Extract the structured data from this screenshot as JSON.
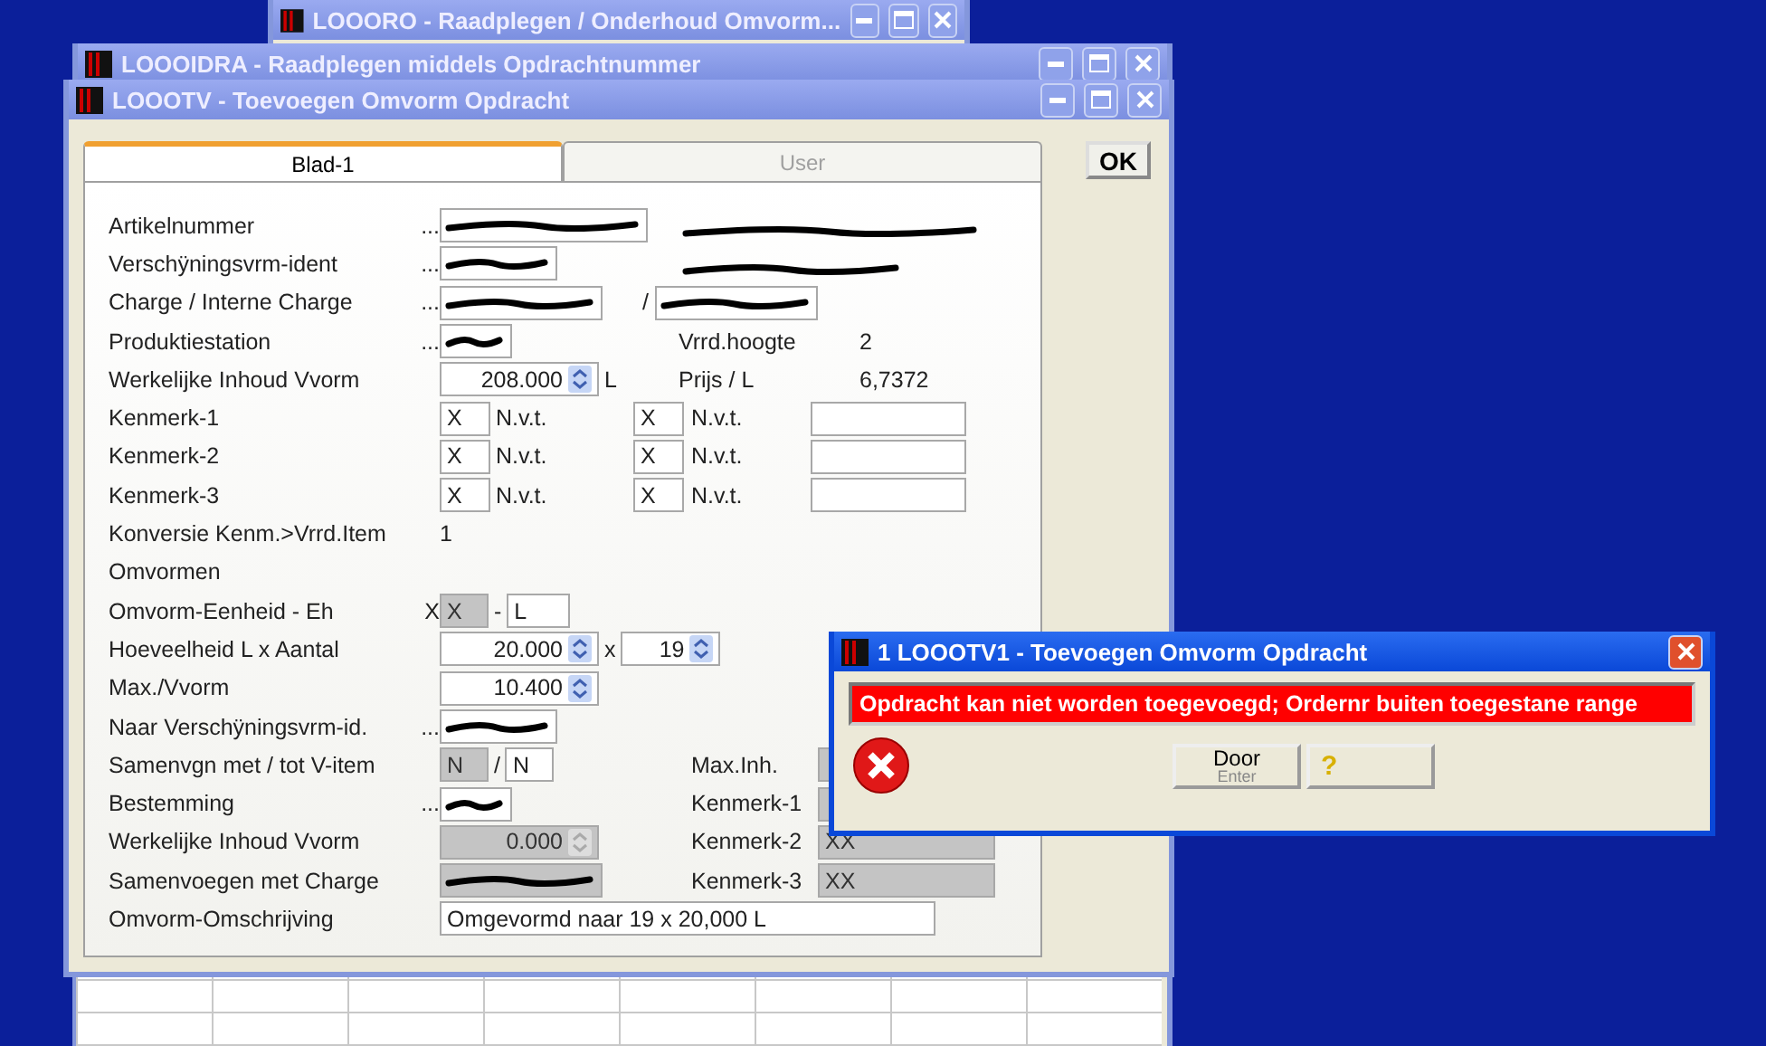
{
  "windows_behind": [
    {
      "title": "LOOORO - Raadplegen / Onderhoud Omvorm..."
    },
    {
      "title": "LOOOIDRA - Raadplegen middels Opdrachtnummer"
    }
  ],
  "window": {
    "title": "LOOOTV - Toevoegen Omvorm Opdracht"
  },
  "tabs": [
    {
      "label": "Blad-1",
      "selected": true
    },
    {
      "label": "User",
      "selected": false
    }
  ],
  "ok_button": "OK",
  "form": {
    "rows": [
      {
        "label": "Artikelnummer",
        "pre": "...",
        "left": [
          {
            "kind": "field",
            "redacted": true
          }
        ],
        "right": [
          {
            "kind": "note",
            "redacted": true
          }
        ]
      },
      {
        "label": "Verschÿningsvrm-ident",
        "pre": "...",
        "left": [
          {
            "kind": "field",
            "redacted": true
          }
        ],
        "right": [
          {
            "kind": "note",
            "redacted": true
          }
        ]
      },
      {
        "label": "Charge / Interne Charge",
        "pre": "...",
        "left": [
          {
            "kind": "field",
            "redacted": true
          }
        ],
        "right": [
          {
            "kind": "text",
            "text": "/"
          },
          {
            "kind": "field",
            "redacted": true
          }
        ]
      },
      {
        "label": "Produktiestation",
        "pre": "...",
        "left": [
          {
            "kind": "field",
            "redacted": true
          }
        ],
        "right": [
          {
            "kind": "text",
            "text": "Vrrd.hoogte"
          },
          {
            "kind": "text",
            "text": "2"
          }
        ]
      },
      {
        "label": "Werkelijke Inhoud Vvorm",
        "left": [
          {
            "kind": "spin",
            "value": "208.000"
          },
          {
            "kind": "text",
            "text": "L"
          }
        ],
        "right": [
          {
            "kind": "text",
            "text": "Prijs / L"
          },
          {
            "kind": "text",
            "text": "6,7372"
          }
        ]
      },
      {
        "label": "Kenmerk-1",
        "left": [
          {
            "kind": "field",
            "value": "X"
          },
          {
            "kind": "text",
            "text": "N.v.t."
          }
        ],
        "right": [
          {
            "kind": "field",
            "value": "X"
          },
          {
            "kind": "text",
            "text": "N.v.t."
          },
          {
            "kind": "field"
          }
        ]
      },
      {
        "label": "Kenmerk-2",
        "left": [
          {
            "kind": "field",
            "value": "X"
          },
          {
            "kind": "text",
            "text": "N.v.t."
          }
        ],
        "right": [
          {
            "kind": "field",
            "value": "X"
          },
          {
            "kind": "text",
            "text": "N.v.t."
          },
          {
            "kind": "field"
          }
        ]
      },
      {
        "label": "Kenmerk-3",
        "left": [
          {
            "kind": "field",
            "value": "X"
          },
          {
            "kind": "text",
            "text": "N.v.t."
          }
        ],
        "right": [
          {
            "kind": "field",
            "value": "X"
          },
          {
            "kind": "text",
            "text": "N.v.t."
          },
          {
            "kind": "field"
          }
        ]
      },
      {
        "label": "Konversie Kenm.>Vrrd.Item",
        "left": [
          {
            "kind": "text",
            "text": "1"
          }
        ]
      },
      {
        "label": "Omvormen"
      },
      {
        "label": "Omvorm-Eenheid - Eh",
        "pre": "X",
        "left": [
          {
            "kind": "field",
            "value": "X",
            "disabled": true
          },
          {
            "kind": "text",
            "text": "-"
          },
          {
            "kind": "field",
            "value": "L"
          }
        ]
      },
      {
        "label": "Hoeveelheid L  x Aantal",
        "left": [
          {
            "kind": "spin",
            "value": "20.000"
          },
          {
            "kind": "text",
            "text": "x"
          },
          {
            "kind": "spin",
            "value": "19"
          }
        ]
      },
      {
        "label": "Max./Vvorm",
        "left": [
          {
            "kind": "spin",
            "value": "10.400"
          }
        ]
      },
      {
        "label": "Naar Verschÿningsvrm-id.",
        "pre": "...",
        "left": [
          {
            "kind": "field",
            "redacted": true
          }
        ]
      },
      {
        "label": "Samenvgn met / tot V-item",
        "left": [
          {
            "kind": "field",
            "value": "N",
            "disabled": true
          },
          {
            "kind": "text",
            "text": "/"
          },
          {
            "kind": "field",
            "value": "N"
          }
        ],
        "right": [
          {
            "kind": "label",
            "text": "Max.Inh."
          },
          {
            "kind": "field",
            "disabled": true
          }
        ]
      },
      {
        "label": "Bestemming",
        "pre": "...",
        "left": [
          {
            "kind": "field",
            "redacted": true
          }
        ],
        "right": [
          {
            "kind": "label",
            "text": "Kenmerk-1"
          },
          {
            "kind": "field",
            "disabled": true
          }
        ]
      },
      {
        "label": "Werkelijke Inhoud Vvorm",
        "left": [
          {
            "kind": "spin",
            "value": "0.000",
            "disabled": true
          }
        ],
        "right": [
          {
            "kind": "label",
            "text": "Kenmerk-2"
          },
          {
            "kind": "field",
            "value": "XX",
            "disabled": true
          }
        ]
      },
      {
        "label": "Samenvoegen met Charge",
        "left": [
          {
            "kind": "field",
            "redacted": true,
            "disabled": true
          }
        ],
        "right": [
          {
            "kind": "label",
            "text": "Kenmerk-3"
          },
          {
            "kind": "field",
            "value": "XX",
            "disabled": true
          }
        ]
      },
      {
        "label": "Omvorm-Omschrijving",
        "left": [
          {
            "kind": "field",
            "value": "Omgevormd naar 19 x 20,000 L"
          }
        ]
      }
    ]
  },
  "dialog": {
    "title": "1 LOOOTV1 - Toevoegen Omvorm Opdracht",
    "message": "Opdracht kan niet worden toegevoegd; Ordernr buiten toegestane range",
    "buttons": [
      {
        "label": "Door",
        "hint": "Enter"
      },
      {
        "label": "?"
      }
    ]
  }
}
